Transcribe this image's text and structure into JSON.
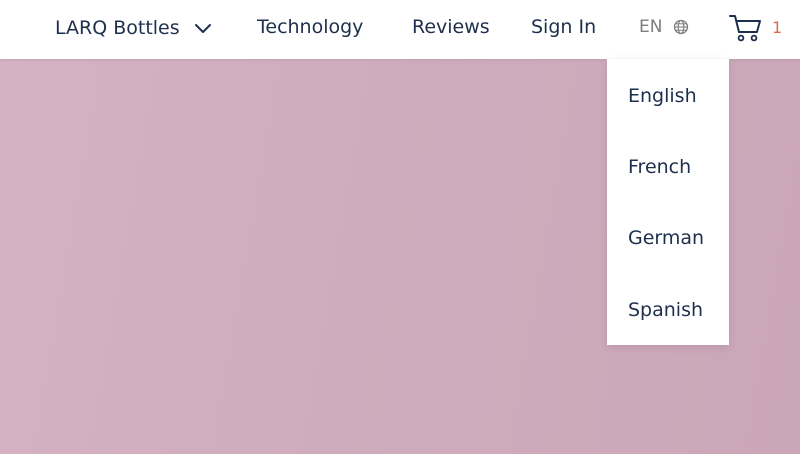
{
  "nav": {
    "products_label": "LARQ Bottles",
    "technology_label": "Technology",
    "reviews_label": "Reviews",
    "signin_label": "Sign In"
  },
  "language": {
    "current_code": "EN",
    "options": [
      "English",
      "French",
      "German",
      "Spanish"
    ]
  },
  "cart": {
    "count": "1"
  },
  "icons": {
    "products_dropdown": "chevron-down-icon",
    "language": "globe-icon",
    "cart": "cart-icon"
  },
  "colors": {
    "nav_text": "#1e2f4d",
    "muted_text": "#7d7d7d",
    "cart_count": "#e06a50",
    "hero_background": "#d1aebe",
    "header_background": "#ffffff"
  }
}
